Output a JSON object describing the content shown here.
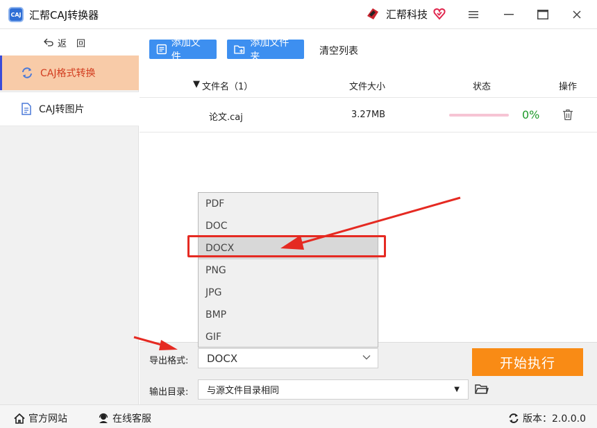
{
  "app": {
    "logo_text": "CAJ",
    "title": "汇帮CAJ转换器",
    "brand": "汇帮科技"
  },
  "sidebar": {
    "back_label": "返回",
    "items": [
      {
        "label": "CAJ格式转换",
        "icon": "refresh-icon",
        "active": true
      },
      {
        "label": "CAJ转图片",
        "icon": "document-icon",
        "active": false
      }
    ]
  },
  "toolbar": {
    "add_file": "添加文件",
    "add_folder": "添加文件夹",
    "clear_list": "清空列表"
  },
  "table": {
    "headers": {
      "name": "文件名（1）",
      "size": "文件大小",
      "status": "状态",
      "action": "操作"
    },
    "rows": [
      {
        "name": "论文.caj",
        "size": "3.27MB",
        "progress_percent": 0,
        "status_text": "0%"
      }
    ]
  },
  "format_dropdown": {
    "options": [
      "PDF",
      "DOC",
      "DOCX",
      "PNG",
      "JPG",
      "BMP",
      "GIF"
    ],
    "highlighted": "DOCX"
  },
  "settings": {
    "format_label": "导出格式:",
    "format_value": "DOCX",
    "output_label": "输出目录:",
    "output_value": "与源文件目录相同",
    "start_button": "开始执行"
  },
  "statusbar": {
    "website": "官方网站",
    "support": "在线客服",
    "version": "版本：2.0.0.0"
  },
  "colors": {
    "accent_blue": "#3d8ff0",
    "start_orange": "#f98b15",
    "active_nav_bg": "#f8cba8",
    "active_nav_text": "#d23c1f",
    "annotation_red": "#e52a22",
    "progress_green": "#1e9a2a"
  }
}
